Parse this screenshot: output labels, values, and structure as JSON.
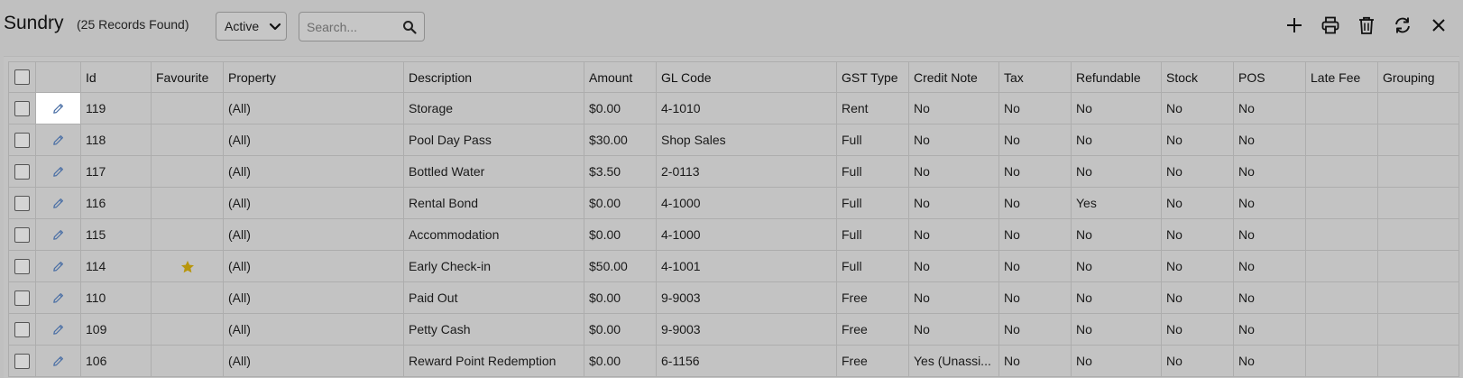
{
  "header": {
    "title": "Sundry",
    "record_count": "(25 Records Found)",
    "status_value": "Active",
    "search_placeholder": "Search..."
  },
  "toolbar": {
    "icons": [
      "plus-icon",
      "printer-icon",
      "trash-icon",
      "refresh-icon",
      "close-icon"
    ]
  },
  "colors": {
    "background": "#c0c0c0",
    "edit_icon": "#4a6fa5",
    "favourite_star": "#b8960c"
  },
  "table": {
    "columns": [
      "Id",
      "Favourite",
      "Property",
      "Description",
      "Amount",
      "GL Code",
      "GST Type",
      "Credit Note",
      "Tax",
      "Refundable",
      "Stock",
      "POS",
      "Late Fee",
      "Grouping"
    ],
    "rows": [
      {
        "id": "119",
        "favourite": false,
        "property": "(All)",
        "description": "Storage",
        "amount": "$0.00",
        "gl_code": "4-1010",
        "gst_type": "Rent",
        "credit_note": "No",
        "tax": "No",
        "refundable": "No",
        "stock": "No",
        "pos": "No",
        "late_fee": "",
        "grouping": ""
      },
      {
        "id": "118",
        "favourite": false,
        "property": "(All)",
        "description": "Pool Day Pass",
        "amount": "$30.00",
        "gl_code": "Shop Sales",
        "gst_type": "Full",
        "credit_note": "No",
        "tax": "No",
        "refundable": "No",
        "stock": "No",
        "pos": "No",
        "late_fee": "",
        "grouping": ""
      },
      {
        "id": "117",
        "favourite": false,
        "property": "(All)",
        "description": "Bottled Water",
        "amount": "$3.50",
        "gl_code": "2-0113",
        "gst_type": "Full",
        "credit_note": "No",
        "tax": "No",
        "refundable": "No",
        "stock": "No",
        "pos": "No",
        "late_fee": "",
        "grouping": ""
      },
      {
        "id": "116",
        "favourite": false,
        "property": "(All)",
        "description": "Rental Bond",
        "amount": "$0.00",
        "gl_code": "4-1000",
        "gst_type": "Full",
        "credit_note": "No",
        "tax": "No",
        "refundable": "Yes",
        "stock": "No",
        "pos": "No",
        "late_fee": "",
        "grouping": ""
      },
      {
        "id": "115",
        "favourite": false,
        "property": "(All)",
        "description": "Accommodation",
        "amount": "$0.00",
        "gl_code": "4-1000",
        "gst_type": "Full",
        "credit_note": "No",
        "tax": "No",
        "refundable": "No",
        "stock": "No",
        "pos": "No",
        "late_fee": "",
        "grouping": ""
      },
      {
        "id": "114",
        "favourite": true,
        "property": "(All)",
        "description": "Early Check-in",
        "amount": "$50.00",
        "gl_code": "4-1001",
        "gst_type": "Full",
        "credit_note": "No",
        "tax": "No",
        "refundable": "No",
        "stock": "No",
        "pos": "No",
        "late_fee": "",
        "grouping": ""
      },
      {
        "id": "110",
        "favourite": false,
        "property": "(All)",
        "description": "Paid Out",
        "amount": "$0.00",
        "gl_code": "9-9003",
        "gst_type": "Free",
        "credit_note": "No",
        "tax": "No",
        "refundable": "No",
        "stock": "No",
        "pos": "No",
        "late_fee": "",
        "grouping": ""
      },
      {
        "id": "109",
        "favourite": false,
        "property": "(All)",
        "description": "Petty Cash",
        "amount": "$0.00",
        "gl_code": "9-9003",
        "gst_type": "Free",
        "credit_note": "No",
        "tax": "No",
        "refundable": "No",
        "stock": "No",
        "pos": "No",
        "late_fee": "",
        "grouping": ""
      },
      {
        "id": "106",
        "favourite": false,
        "property": "(All)",
        "description": "Reward Point Redemption",
        "amount": "$0.00",
        "gl_code": "6-1156",
        "gst_type": "Free",
        "credit_note": "Yes (Unassi...",
        "tax": "No",
        "refundable": "No",
        "stock": "No",
        "pos": "No",
        "late_fee": "",
        "grouping": ""
      }
    ]
  }
}
